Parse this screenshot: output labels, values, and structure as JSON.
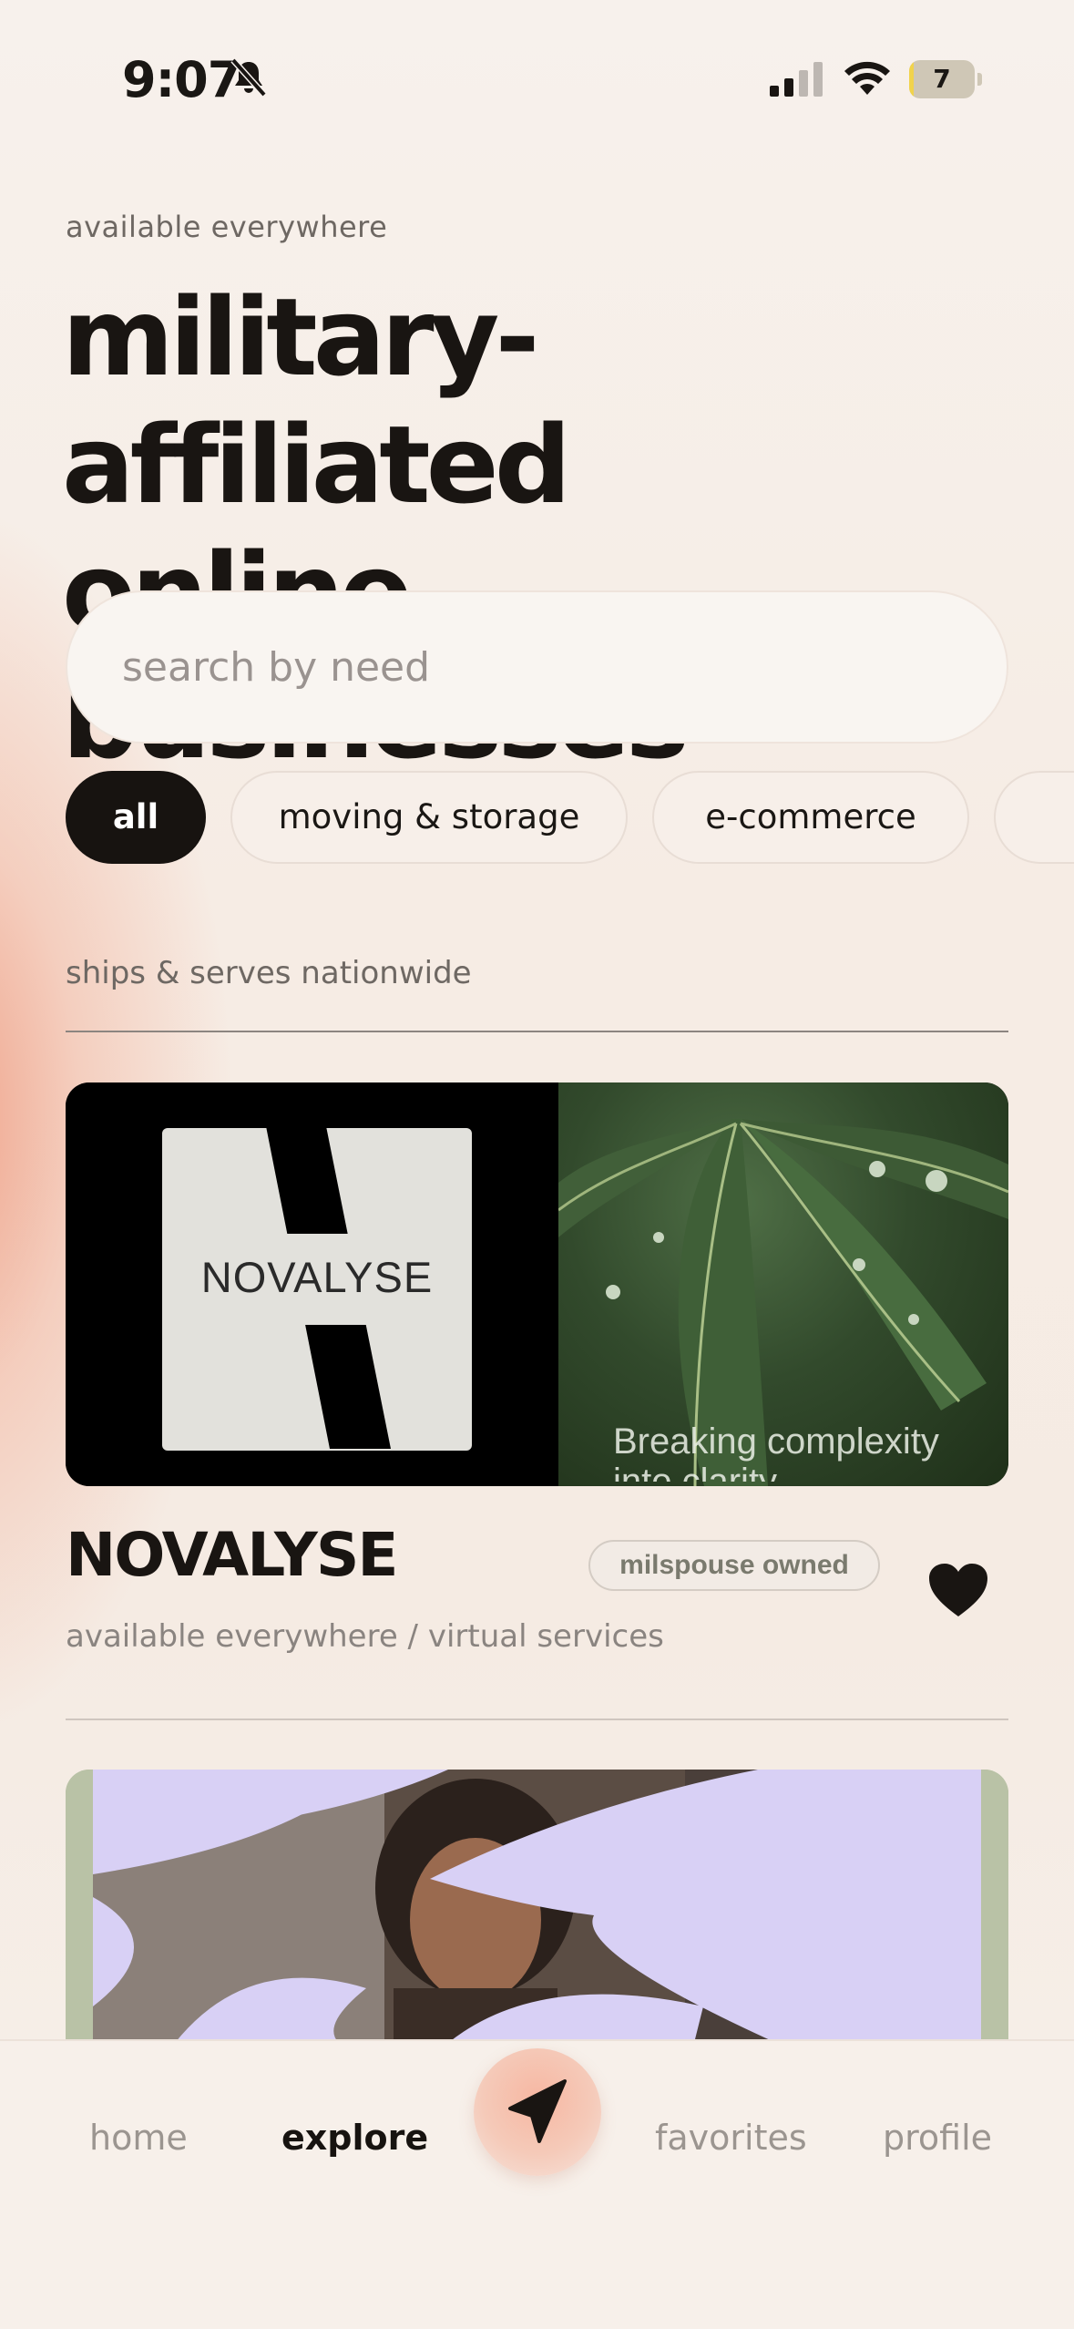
{
  "status_bar": {
    "time": "9:07",
    "battery": "7",
    "battery_level": 0.07
  },
  "header": {
    "eyebrow": "available everywhere",
    "title_line1": "military-affiliated",
    "title_line2": "online businesses"
  },
  "search": {
    "placeholder": "search by need",
    "value": ""
  },
  "filters": [
    {
      "label": "all",
      "active": true
    },
    {
      "label": "moving & storage",
      "active": false
    },
    {
      "label": "e-commerce",
      "active": false
    },
    {
      "label": "",
      "active": false
    }
  ],
  "section": {
    "label": "ships & serves nationwide"
  },
  "listings": [
    {
      "name": "NOVALYSE",
      "logo_text": "NOVALYSE",
      "image_caption": "Breaking complexity into clarity",
      "badge": "milspouse owned",
      "meta": "available everywhere / virtual services",
      "favorited": true
    }
  ],
  "tabbar": {
    "home": "home",
    "explore": "explore",
    "favorites": "favorites",
    "profile": "profile",
    "active": "explore"
  },
  "icons": {
    "bell": "bell-slash-icon",
    "signal": "cellular-signal-icon",
    "wifi": "wifi-icon",
    "heart": "heart-filled-icon",
    "nav": "navigation-arrow-icon"
  },
  "colors": {
    "ink": "#191512",
    "chip_active": "#171310",
    "accent_gradient": "#ee8c6e",
    "badge_text": "#7a7a6e"
  }
}
